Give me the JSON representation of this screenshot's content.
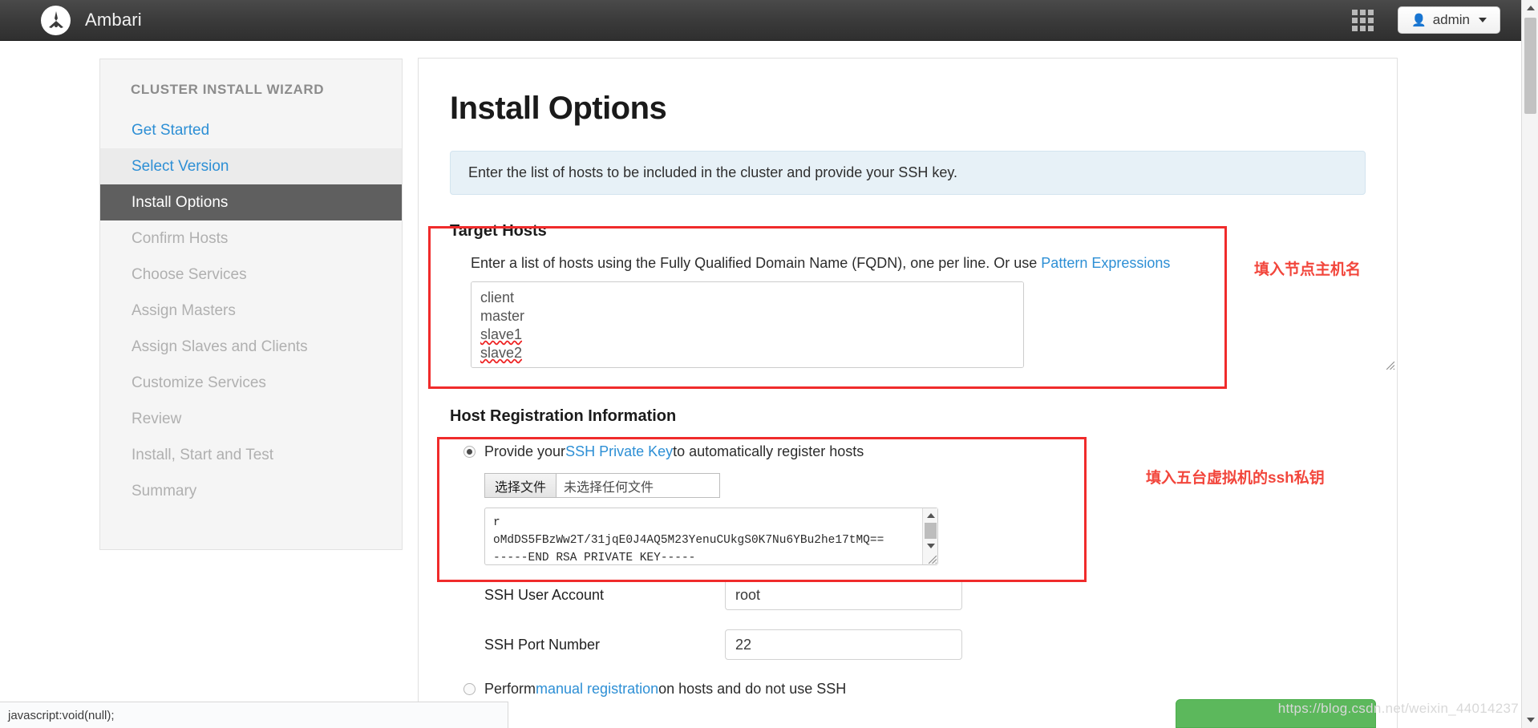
{
  "navbar": {
    "logo_icon": "ambari-logo-icon",
    "brand": "Ambari",
    "grid_icon": "grid-apps-icon",
    "user_icon": "user-icon",
    "user_label": "admin",
    "caret_icon": "chevron-down-icon"
  },
  "sidebar": {
    "title": "CLUSTER INSTALL WIZARD",
    "items": [
      {
        "label": "Get Started",
        "state": "done"
      },
      {
        "label": "Select Version",
        "state": "prev"
      },
      {
        "label": "Install Options",
        "state": "active"
      },
      {
        "label": "Confirm Hosts",
        "state": "todo"
      },
      {
        "label": "Choose Services",
        "state": "todo"
      },
      {
        "label": "Assign Masters",
        "state": "todo"
      },
      {
        "label": "Assign Slaves and Clients",
        "state": "todo"
      },
      {
        "label": "Customize Services",
        "state": "todo"
      },
      {
        "label": "Review",
        "state": "todo"
      },
      {
        "label": "Install, Start and Test",
        "state": "todo"
      },
      {
        "label": "Summary",
        "state": "todo"
      }
    ]
  },
  "main": {
    "title": "Install Options",
    "alert": "Enter the list of hosts to be included in the cluster and provide your SSH key.",
    "target_hosts": {
      "heading": "Target Hosts",
      "instruction_prefix": "Enter a list of hosts using the Fully Qualified Domain Name (FQDN), one per line. Or use ",
      "instruction_link": "Pattern Expressions",
      "hosts_value": "client\nmaster\nslave1\nslave2",
      "host_lines": [
        "client",
        "master",
        "slave1",
        "slave2"
      ],
      "misspelled_lines": [
        "slave1",
        "slave2"
      ]
    },
    "host_registration": {
      "heading": "Host Registration Information",
      "ssh_option": {
        "selected": true,
        "prefix": "Provide your ",
        "link": "SSH Private Key",
        "suffix": " to automatically register hosts"
      },
      "file_picker": {
        "button_label": "选择文件",
        "file_status": "未选择任何文件"
      },
      "private_key_value": "r\noMdDS5FBzWw2T/31jqE0J4AQ5M23YenuCUkgS0K7Nu6YBu2he17tMQ==\n-----END RSA PRIVATE KEY-----",
      "ssh_user": {
        "label": "SSH User Account",
        "value": "root"
      },
      "ssh_port": {
        "label": "SSH Port Number",
        "value": "22"
      },
      "manual_option": {
        "selected": false,
        "prefix": "Perform ",
        "link": "manual registration",
        "suffix": " on hosts and do not use SSH"
      }
    }
  },
  "annotations": [
    {
      "text": "填入节点主机名",
      "color": "#f2463c"
    },
    {
      "text": "填入五台虚拟机的ssh私钥",
      "color": "#f2463c"
    }
  ],
  "status_bar": {
    "text": "javascript:void(null);"
  },
  "watermark": {
    "text": "https://blog.csdn.net/weixin_44014237"
  },
  "colors": {
    "accent_link": "#2d8fd5",
    "active_item_bg": "#5f5f5f",
    "annotation_red": "#f02b2b",
    "primary_button": "#5cb85c"
  }
}
